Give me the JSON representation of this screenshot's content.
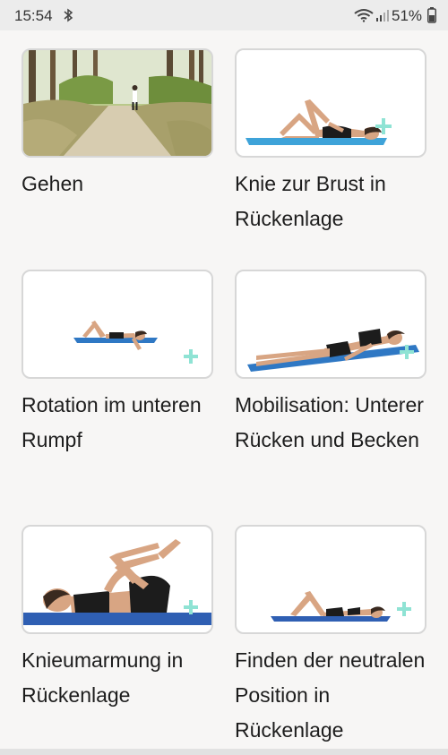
{
  "status_bar": {
    "time": "15:54",
    "battery": "51%",
    "icons": [
      "bluetooth-icon",
      "wifi-icon",
      "signal-icon",
      "battery-icon"
    ]
  },
  "exercises": [
    {
      "title": "Gehen",
      "thumbnail": "forest-walking-photo"
    },
    {
      "title": "Knie zur Brust in Rückenlage",
      "thumbnail": "knee-to-chest-figure"
    },
    {
      "title": "Rotation im unteren Rumpf",
      "thumbnail": "lower-trunk-rotation-figure"
    },
    {
      "title": "Mobilisation: Unterer Rücken und Becken",
      "thumbnail": "lower-back-pelvis-mobilisation-figure"
    },
    {
      "title": "Knieumarmung in Rückenlage",
      "thumbnail": "knee-hug-figure"
    },
    {
      "title": "Finden der neutralen Position in Rückenlage",
      "thumbnail": "neutral-position-figure"
    }
  ],
  "colors": {
    "background": "#f7f6f5",
    "card_border": "#d7d7d7",
    "mat_blue": "#3a8fd8",
    "plus_teal": "#8fe3d4"
  }
}
